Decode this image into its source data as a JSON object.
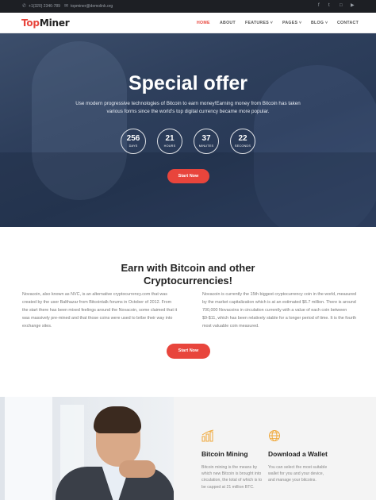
{
  "topbar": {
    "phone": "+1(320) 2346-789",
    "email": "topminer@demolink.org",
    "social": [
      "facebook-icon",
      "twitter-icon",
      "instagram-icon",
      "youtube-icon"
    ]
  },
  "header": {
    "logo_part1": "Top",
    "logo_part2": "Miner",
    "nav": [
      "HOME",
      "ABOUT",
      "FEATURES",
      "PAGES",
      "BLOG",
      "CONTACT"
    ],
    "active": "HOME",
    "accent": "#e8453c"
  },
  "hero": {
    "title": "Special offer",
    "subtitle": "Use modern progressive technologies of Bitcoin to earn money!Earning money from Bitcoin has taken various forms since the world's top digital currency became more popular.",
    "counters": [
      {
        "value": "256",
        "label": "DAYS"
      },
      {
        "value": "21",
        "label": "HOURS"
      },
      {
        "value": "37",
        "label": "MINUTES"
      },
      {
        "value": "22",
        "label": "SECONDS"
      }
    ],
    "button": "Start Now"
  },
  "earn": {
    "title_line1": "Earn with Bitcoin and other",
    "title_line2": "Cryptocurrencies!",
    "col1": "Novacoin, also known as NVC, is an alternative cryptocurrency.com that was created by the user Balthazar from Bitcointalk forums in October of 2012. From the start there has been mixed feelings around the Novacoin, some claimed that it was massively pre-mined and that those coins were used to bribe their way into exchange sites.",
    "col2": "Novacoin is currently the 15th biggest cryptocurrency coin in the world, measured by the market capitalization which is at an estimated $6.7 million. There is around 700,000 Novacoins in circulation currently with a value of each coin between $9-$11, which has been relatively stable for a longer period of time. It is the fourth most valuable coin measured.",
    "button": "Start Now"
  },
  "features": [
    {
      "icon": "chart-icon",
      "title": "Bitcoin Mining",
      "text": "Bitcoin mining is the means by which new Bitcoin is brought into circulation, the total of which is to be capped at 21 million BTC."
    },
    {
      "icon": "globe-icon",
      "title": "Download a Wallet",
      "text": "You can select the most suitable wallet for you and your device, and manage your bitcoins."
    }
  ]
}
